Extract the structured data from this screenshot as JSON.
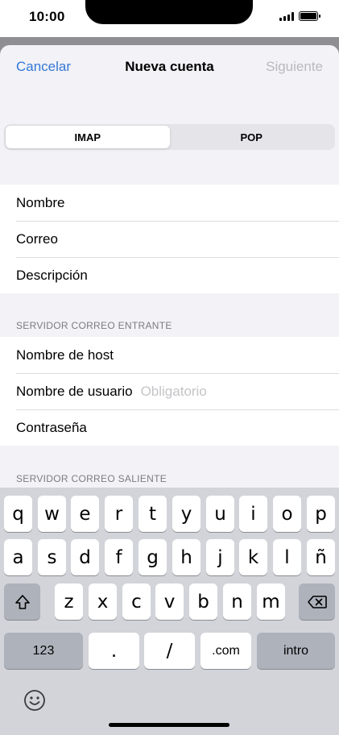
{
  "status_bar": {
    "time": "10:00"
  },
  "nav": {
    "cancel_label": "Cancelar",
    "title": "Nueva cuenta",
    "next_label": "Siguiente"
  },
  "segmented": {
    "options": [
      "IMAP",
      "POP"
    ],
    "selected": "IMAP"
  },
  "account_fields": [
    {
      "label": "Nombre"
    },
    {
      "label": "Correo"
    },
    {
      "label": "Descripción"
    }
  ],
  "incoming": {
    "header": "SERVIDOR CORREO ENTRANTE",
    "fields": [
      {
        "label": "Nombre de host",
        "placeholder": ""
      },
      {
        "label": "Nombre de usuario",
        "placeholder": "Obligatorio"
      },
      {
        "label": "Contraseña",
        "placeholder": ""
      }
    ]
  },
  "outgoing": {
    "header": "SERVIDOR CORREO SALIENTE"
  },
  "keyboard": {
    "row1": [
      "q",
      "w",
      "e",
      "r",
      "t",
      "y",
      "u",
      "i",
      "o",
      "p"
    ],
    "row2": [
      "a",
      "s",
      "d",
      "f",
      "g",
      "h",
      "j",
      "k",
      "l",
      "ñ"
    ],
    "row3": [
      "z",
      "x",
      "c",
      "v",
      "b",
      "n",
      "m"
    ],
    "numbers_label": "123",
    "dot_label": ".",
    "slash_label": "/",
    "dotcom_label": ".com",
    "return_label": "intro",
    "shift_icon": "shift-arrow-icon",
    "delete_icon": "backspace-icon",
    "emoji_icon": "smiley-face-icon"
  },
  "colors": {
    "accent": "#3478d6",
    "disabled": "#b9b9be",
    "keyboard_bg": "#d2d4da"
  }
}
